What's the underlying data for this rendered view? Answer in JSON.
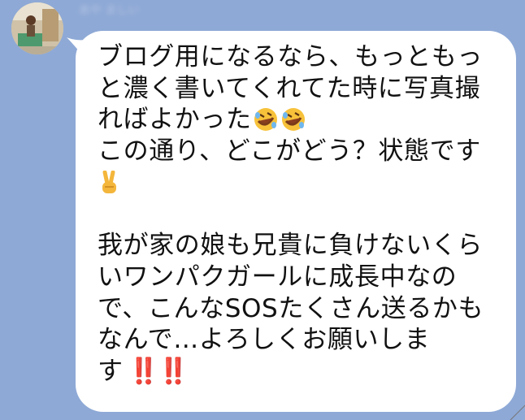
{
  "sender": {
    "name": "あや ましい",
    "avatar_icon": "profile-photo-child-icon"
  },
  "message": {
    "lines": [
      "ブログ用になるなら、もっともっ",
      "と濃く書いてくれてた時に写真撮",
      "ればよかった",
      "この通り、どこがどう？状態です",
      "",
      "",
      "我が家の娘も兄貴に負けないくら",
      "いワンパクガールに成長中なの",
      "で、こんなSOSたくさん送るかも",
      "なんで…よろしくお願いしま",
      "す"
    ],
    "emojis": {
      "line3": [
        "rolling-on-floor-laughing-icon",
        "rolling-on-floor-laughing-icon"
      ],
      "line5": [
        "victory-hand-icon"
      ],
      "line11": [
        "double-exclamation-icon",
        "double-exclamation-icon"
      ]
    },
    "exclaim_text": "‼️‼️"
  },
  "colors": {
    "background": "#8ea9d6",
    "bubble": "#ffffff",
    "text": "#111111",
    "exclaim": "#e11d20"
  }
}
